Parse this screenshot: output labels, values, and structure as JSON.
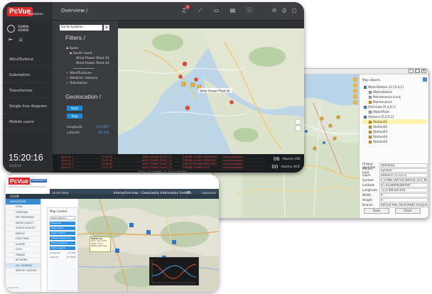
{
  "dark_window": {
    "brand": {
      "name": "PcVue",
      "suffix": "Solutions"
    },
    "breadcrumb": "Overview /",
    "notification_count": "4",
    "user": {
      "name": "ADMIN",
      "role": "ADMIN"
    },
    "nav": [
      "WindTurbine",
      "Substation",
      "Transformer",
      "Single line diagram",
      "Mobile users"
    ],
    "clock": "15:20:16",
    "date": "5/28/16",
    "select_placeholder": "Go to turbine...",
    "filters_title": "Filters /",
    "tree": {
      "country": "Spain",
      "region": "South coast",
      "plants": [
        "Wind Power Plant 01",
        "Wind Power Plant 02"
      ],
      "layers": [
        "WindTurbines",
        "Weather stations",
        "Substation"
      ]
    },
    "geolocation_title": "Geolocation /",
    "start_button": "Start",
    "stop_button": "Stop",
    "longitude": {
      "label": "Longitude",
      "value": "6.74807"
    },
    "latitude": {
      "label": "Latitude",
      "value": "40.541"
    },
    "map_label": "Wind Power Plant 01",
    "alarm_rows": [
      [
        "Severity 1",
        "15:20:16",
        "WIND_POWER_PLANT_01",
        "TURBINE.ALARM.OVERSPEED",
        "Unacknowledged"
      ],
      [
        "Severity 1",
        "15:19:48",
        "WIND_POWER_PLANT_01",
        "TURBINE.ALARM.VIBRATION",
        "Unacknowledged"
      ],
      [
        "Severity 2",
        "15:18:05",
        "WIND_POWER_PLANT_02",
        "SUBSTATION.BREAKER.OPEN",
        "Unacknowledged"
      ],
      [
        "Severity 2",
        "15:17:33",
        "WIND_POWER_PLANT_02",
        "TURBINE.ALARM.PITCH",
        "Unacknowledged"
      ]
    ],
    "alarm_footer": "Alarms - Acknowledge - All - Unacknowledged",
    "alarms_on": {
      "count": "06",
      "label": "Alarms ON"
    },
    "alarms_ack": {
      "count": "00",
      "label": "Alarms ACK"
    }
  },
  "back_window": {
    "panel_title": "Map objects",
    "tree": [
      {
        "label": "WaterStation (2) [5,4,1]",
        "kind": "blue"
      },
      {
        "label": "WaterStation",
        "kind": "grey"
      },
      {
        "label": "Maintenance truck",
        "kind": "grey"
      },
      {
        "label": "Maintenance",
        "kind": "orange"
      },
      {
        "label": "Overview [5,4,0,1]",
        "kind": "blue"
      },
      {
        "label": "WaterPlant",
        "kind": "grey"
      },
      {
        "label": "Stations [5,5,0,1]",
        "kind": "blue"
      },
      {
        "label": "Station01",
        "kind": "orange",
        "selected": true
      },
      {
        "label": "Station02",
        "kind": "orange"
      },
      {
        "label": "Station03",
        "kind": "orange"
      },
      {
        "label": "Station04",
        "kind": "orange"
      },
      {
        "label": "Station05",
        "kind": "orange"
      }
    ],
    "form": [
      {
        "key": "Unique identifier",
        "value": "Station01"
      },
      {
        "key": "Marker type",
        "value": "Symbol"
      },
      {
        "key": "Layer",
        "value": "Stations [5,5,0,1]"
      },
      {
        "key": "Symbol",
        "value": "L_SYMB_WATER.WATER_STS_MARK"
      },
      {
        "key": "Latitude",
        "value": "47.4528906086494"
      },
      {
        "key": "Longitude",
        "value": "-3.07990397954"
      },
      {
        "key": "Width",
        "value": "0"
      },
      {
        "key": "Height",
        "value": "0"
      },
      {
        "key": "Branch",
        "value": "WATER.PRETREATMENT.PumpingStation"
      }
    ],
    "save_button": "Save",
    "close_button": "Close"
  },
  "light_window": {
    "brand": {
      "name": "PcVue",
      "suffix": "Solutions",
      "tagline": "Supervisory Control and Data Acquisition"
    },
    "user_label": "LOGIN",
    "date": "10 OF 2016",
    "title": "Interactive map - Geographic Information System",
    "language": "LANGUAGE",
    "nav_header": "NAVIGATION",
    "nav": [
      "HOME",
      "OVERVIEW",
      "PRE-TREATMENT",
      "WATER QUALITY",
      "SLUDGE QUALITY",
      "ENERGY",
      "FUNCTIONS",
      "ALARMS",
      "LOGS",
      "TRENDS",
      "NETWORK",
      "GIS / MAPPING",
      "REMOTE CONTROL"
    ],
    "nav_active": "GIS / MAPPING",
    "footer": "15:20:16",
    "control_title": "Map Control",
    "control_select": "Water stations",
    "control_buttons": [
      "Overview",
      "Water plant",
      "Select station",
      "Maintenance truck",
      "Center position",
      "Show objects"
    ],
    "control_kv": [
      [
        "Longitude",
        "-3.0799"
      ],
      [
        "Latitude",
        "47.4528"
      ]
    ],
    "popup": [
      "Station 01",
      "Flow: 12.4 m3/h",
      "Level: 3.2 m",
      "Status: Running"
    ]
  }
}
